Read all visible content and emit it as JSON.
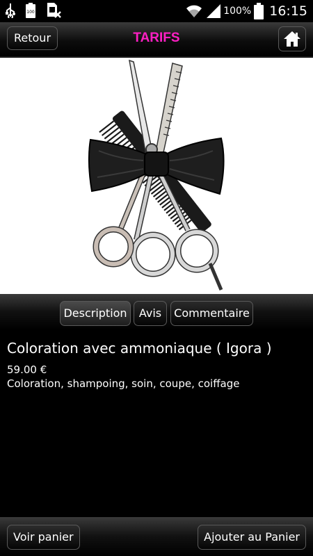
{
  "status_bar": {
    "icons": [
      "usb-icon",
      "battery-100-icon",
      "sim-missing-icon",
      "wifi-icon",
      "signal-icon",
      "battery-icon"
    ],
    "battery_label": "100",
    "battery_percent": "100%",
    "time": "16:15"
  },
  "header": {
    "back_label": "Retour",
    "title": "TARIFS",
    "title_color": "#ff1fc4",
    "home_icon": "home-icon"
  },
  "hero": {
    "image": "scissors-comb-bowtie-illustration"
  },
  "tabs": [
    {
      "label": "Description",
      "active": true
    },
    {
      "label": "Avis",
      "active": false
    },
    {
      "label": "Commentaire",
      "active": false
    }
  ],
  "product": {
    "title": "Coloration avec ammoniaque ( Igora )",
    "price": "59.00 €",
    "description": "Coloration, shampoing, soin, coupe, coiffage"
  },
  "footer": {
    "cart_label": "Voir panier",
    "add_label": "Ajouter au Panier"
  }
}
